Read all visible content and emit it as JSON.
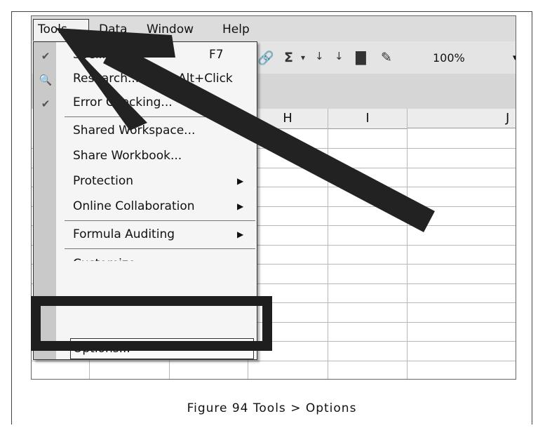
{
  "menubar": {
    "items": [
      "Tools",
      "Data",
      "Window",
      "Help"
    ]
  },
  "toolbar": {
    "zoom": "100%"
  },
  "columns": [
    "H",
    "I",
    "J"
  ],
  "tools_menu": {
    "items": [
      {
        "label": "Spelling...",
        "shortcut": "F7",
        "icon": "spelling-abc-icon"
      },
      {
        "label": "Research...",
        "shortcut": "Alt+Click",
        "icon": "research-icon"
      },
      {
        "label": "Error Checking...",
        "icon": "error-checking-icon"
      },
      {
        "label": "Shared Workspace..."
      },
      {
        "label": "Share Workbook..."
      },
      {
        "label": "Protection",
        "submenu": true
      },
      {
        "label": "Online Collaboration",
        "submenu": true
      },
      {
        "label": "Formula Auditing",
        "submenu": true
      },
      {
        "label": "Customize..."
      },
      {
        "label": "Options..."
      }
    ]
  },
  "caption": "Figure 94 Tools > Options",
  "colors": {
    "annotation": "#1e1e1e",
    "menu_bg": "#f5f5f5",
    "menubar_bg": "#dcdcdc"
  }
}
